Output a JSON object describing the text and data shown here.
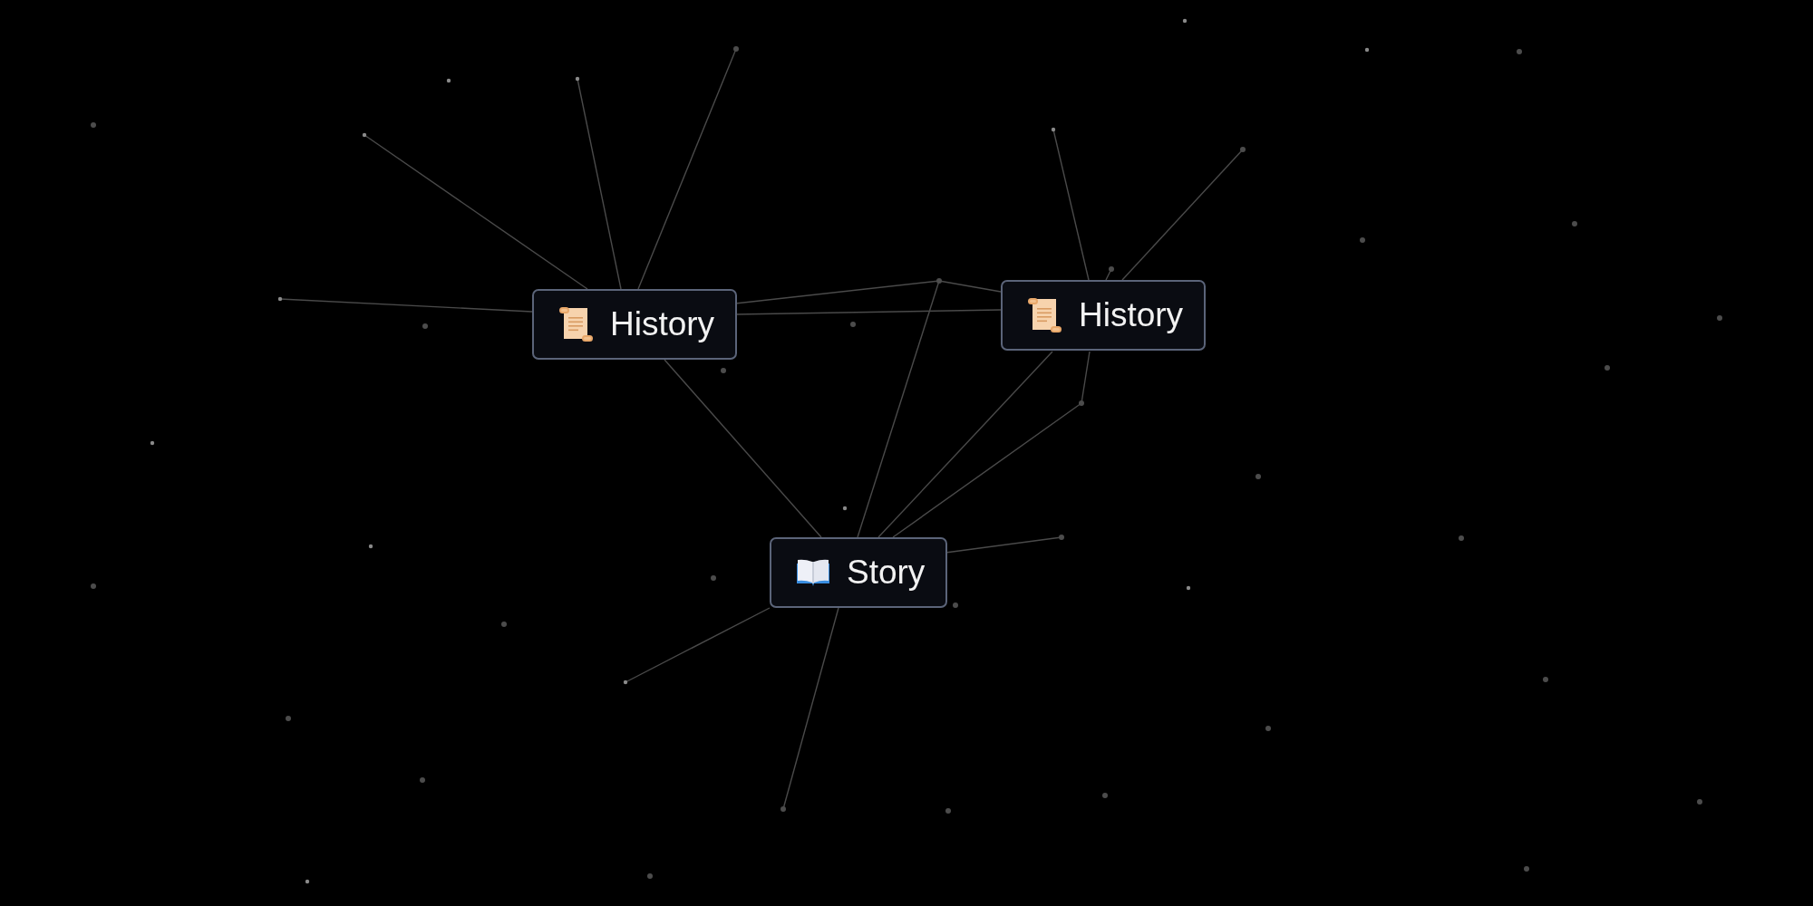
{
  "canvas": {
    "elements": [
      {
        "label": "History",
        "kind": "scroll"
      },
      {
        "label": "History",
        "kind": "scroll"
      },
      {
        "label": "Story",
        "kind": "book"
      }
    ]
  }
}
